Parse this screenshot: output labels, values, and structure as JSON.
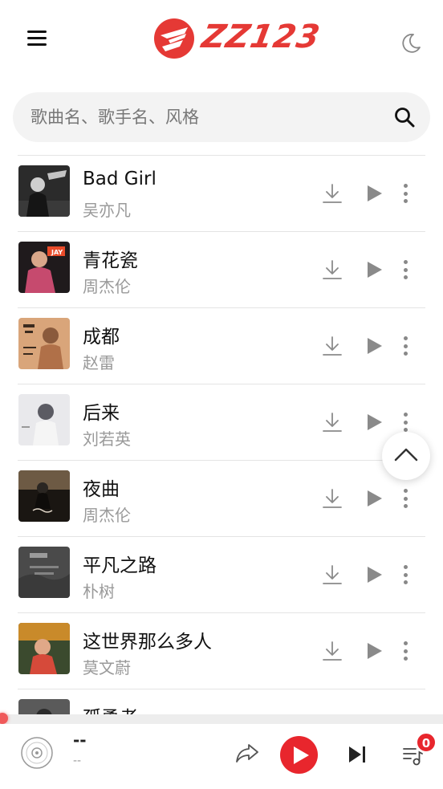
{
  "header": {
    "logo_text": "ZZ123",
    "menu_icon": "hamburger-menu-icon",
    "theme_icon": "moon-icon"
  },
  "search": {
    "placeholder": "歌曲名、歌手名、风格",
    "value": "",
    "icon": "search-icon"
  },
  "songs": [
    {
      "title": "Bad Girl",
      "artist": "吴亦凡"
    },
    {
      "title": "青花瓷",
      "artist": "周杰伦"
    },
    {
      "title": "成都",
      "artist": "赵雷"
    },
    {
      "title": "后来",
      "artist": "刘若英"
    },
    {
      "title": "夜曲",
      "artist": "周杰伦"
    },
    {
      "title": "平凡之路",
      "artist": "朴树"
    },
    {
      "title": "这世界那么多人",
      "artist": "莫文蔚"
    },
    {
      "title": "孤勇者",
      "artist": ""
    }
  ],
  "player": {
    "title": "--",
    "artist": "--",
    "queue_count": "0",
    "progress": 0
  },
  "colors": {
    "accent": "#e8262d",
    "text_secondary": "#999999",
    "search_bg": "#f3f3f3"
  }
}
